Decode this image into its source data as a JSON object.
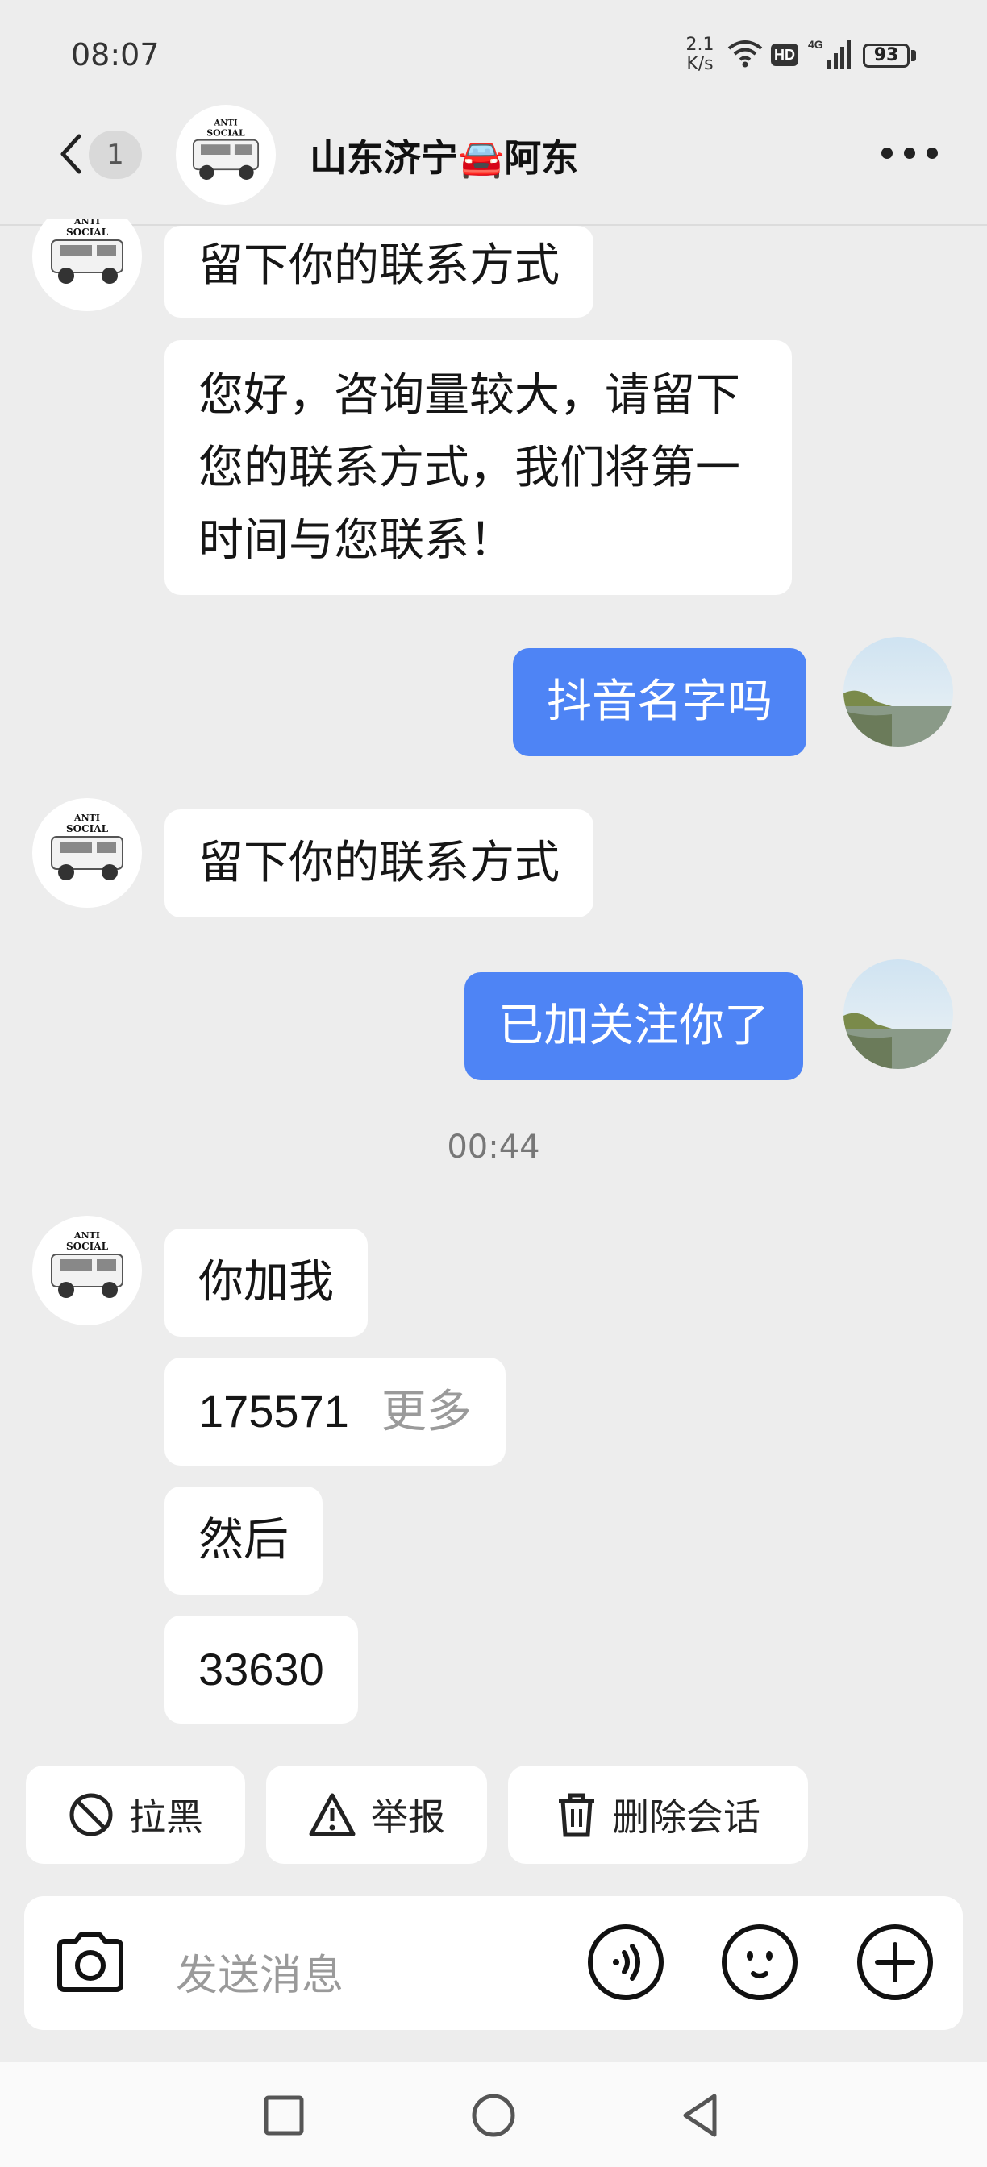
{
  "status_bar": {
    "time": "08:07",
    "net_speed_value": "2.1",
    "net_speed_unit": "K/s",
    "hd": "HD",
    "network": "4G",
    "battery": "93"
  },
  "header": {
    "unread_count": "1",
    "contact_name": "山东济宁🚘阿东"
  },
  "messages": [
    {
      "side": "left",
      "text": "留下你的联系方式"
    },
    {
      "side": "left",
      "text": "您好，咨询量较大，请留下您的联系方式，我们将第一时间与您联系！"
    },
    {
      "side": "right",
      "text": "抖音名字吗"
    },
    {
      "side": "left",
      "text": "留下你的联系方式"
    },
    {
      "side": "right",
      "text": "已加关注你了"
    },
    {
      "side": "time",
      "text": "00:44"
    },
    {
      "side": "left",
      "text": "你加我"
    },
    {
      "side": "left",
      "text": "175571",
      "extra": "更多"
    },
    {
      "side": "left",
      "text": "然后"
    },
    {
      "side": "left",
      "text": "33630"
    }
  ],
  "actions": {
    "block": "拉黑",
    "report": "举报",
    "delete": "删除会话"
  },
  "input": {
    "placeholder": "发送消息"
  },
  "colors": {
    "accent": "#4e84f5",
    "background": "#ededed"
  },
  "icons": [
    "back-chevron-icon",
    "more-dots-icon",
    "camera-icon",
    "voice-icon",
    "emoji-icon",
    "plus-icon",
    "block-icon",
    "warning-icon",
    "trash-icon",
    "nav-recents-icon",
    "nav-home-icon",
    "nav-back-icon"
  ]
}
